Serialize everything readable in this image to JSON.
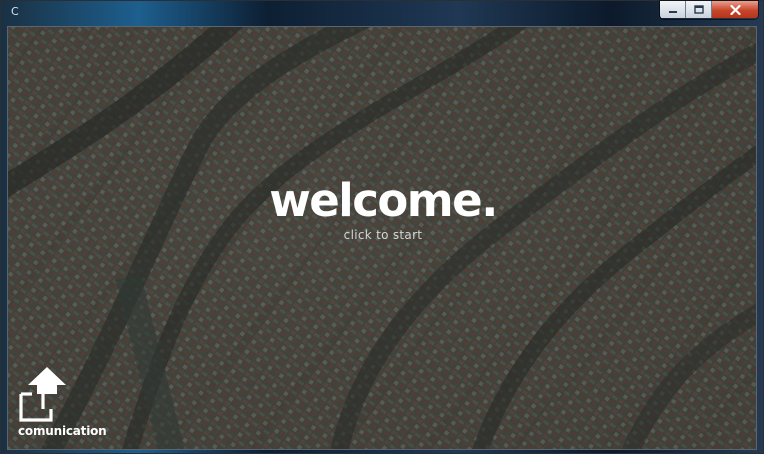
{
  "window": {
    "title": "C",
    "controls": {
      "minimize_icon": "minimize-icon",
      "maximize_icon": "maximize-icon",
      "close_icon": "close-icon"
    }
  },
  "background": {
    "description_icon": "aerial-city-image"
  },
  "welcome": {
    "heading": "welcome.",
    "hint": "click to start"
  },
  "communication_tile": {
    "label": "comunication",
    "icon": "share-arrow-icon"
  },
  "colors": {
    "text_primary": "#ffffff",
    "text_secondary": "#d4d6d6",
    "close_button": "#c7452b"
  }
}
